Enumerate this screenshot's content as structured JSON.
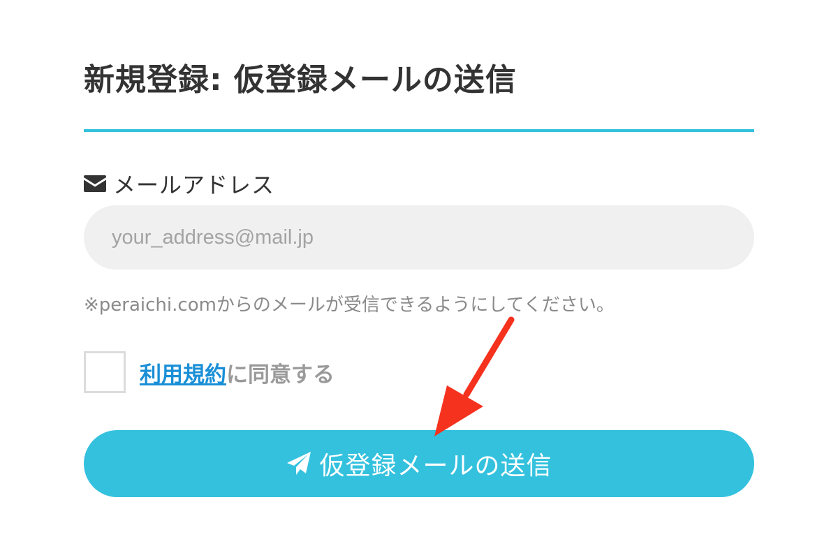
{
  "header": {
    "title": "新規登録: 仮登録メールの送信"
  },
  "form": {
    "email_label": "メールアドレス",
    "email_icon": "envelope-icon",
    "email_value": "",
    "email_placeholder": "your_address@mail.jp",
    "email_note": "※peraichi.comからのメールが受信できるようにしてください。",
    "agree_checked": false,
    "terms_link": "利用規約",
    "agree_suffix": "に同意する",
    "submit_icon": "paper-plane-icon",
    "submit_label": "仮登録メールの送信"
  },
  "colors": {
    "accent": "#33c1de",
    "link": "#1a8fd6",
    "title_text": "#333333",
    "note_text": "#8a8a8a",
    "input_bg": "#f0f0f0",
    "annotation_arrow": "#f5321e"
  }
}
